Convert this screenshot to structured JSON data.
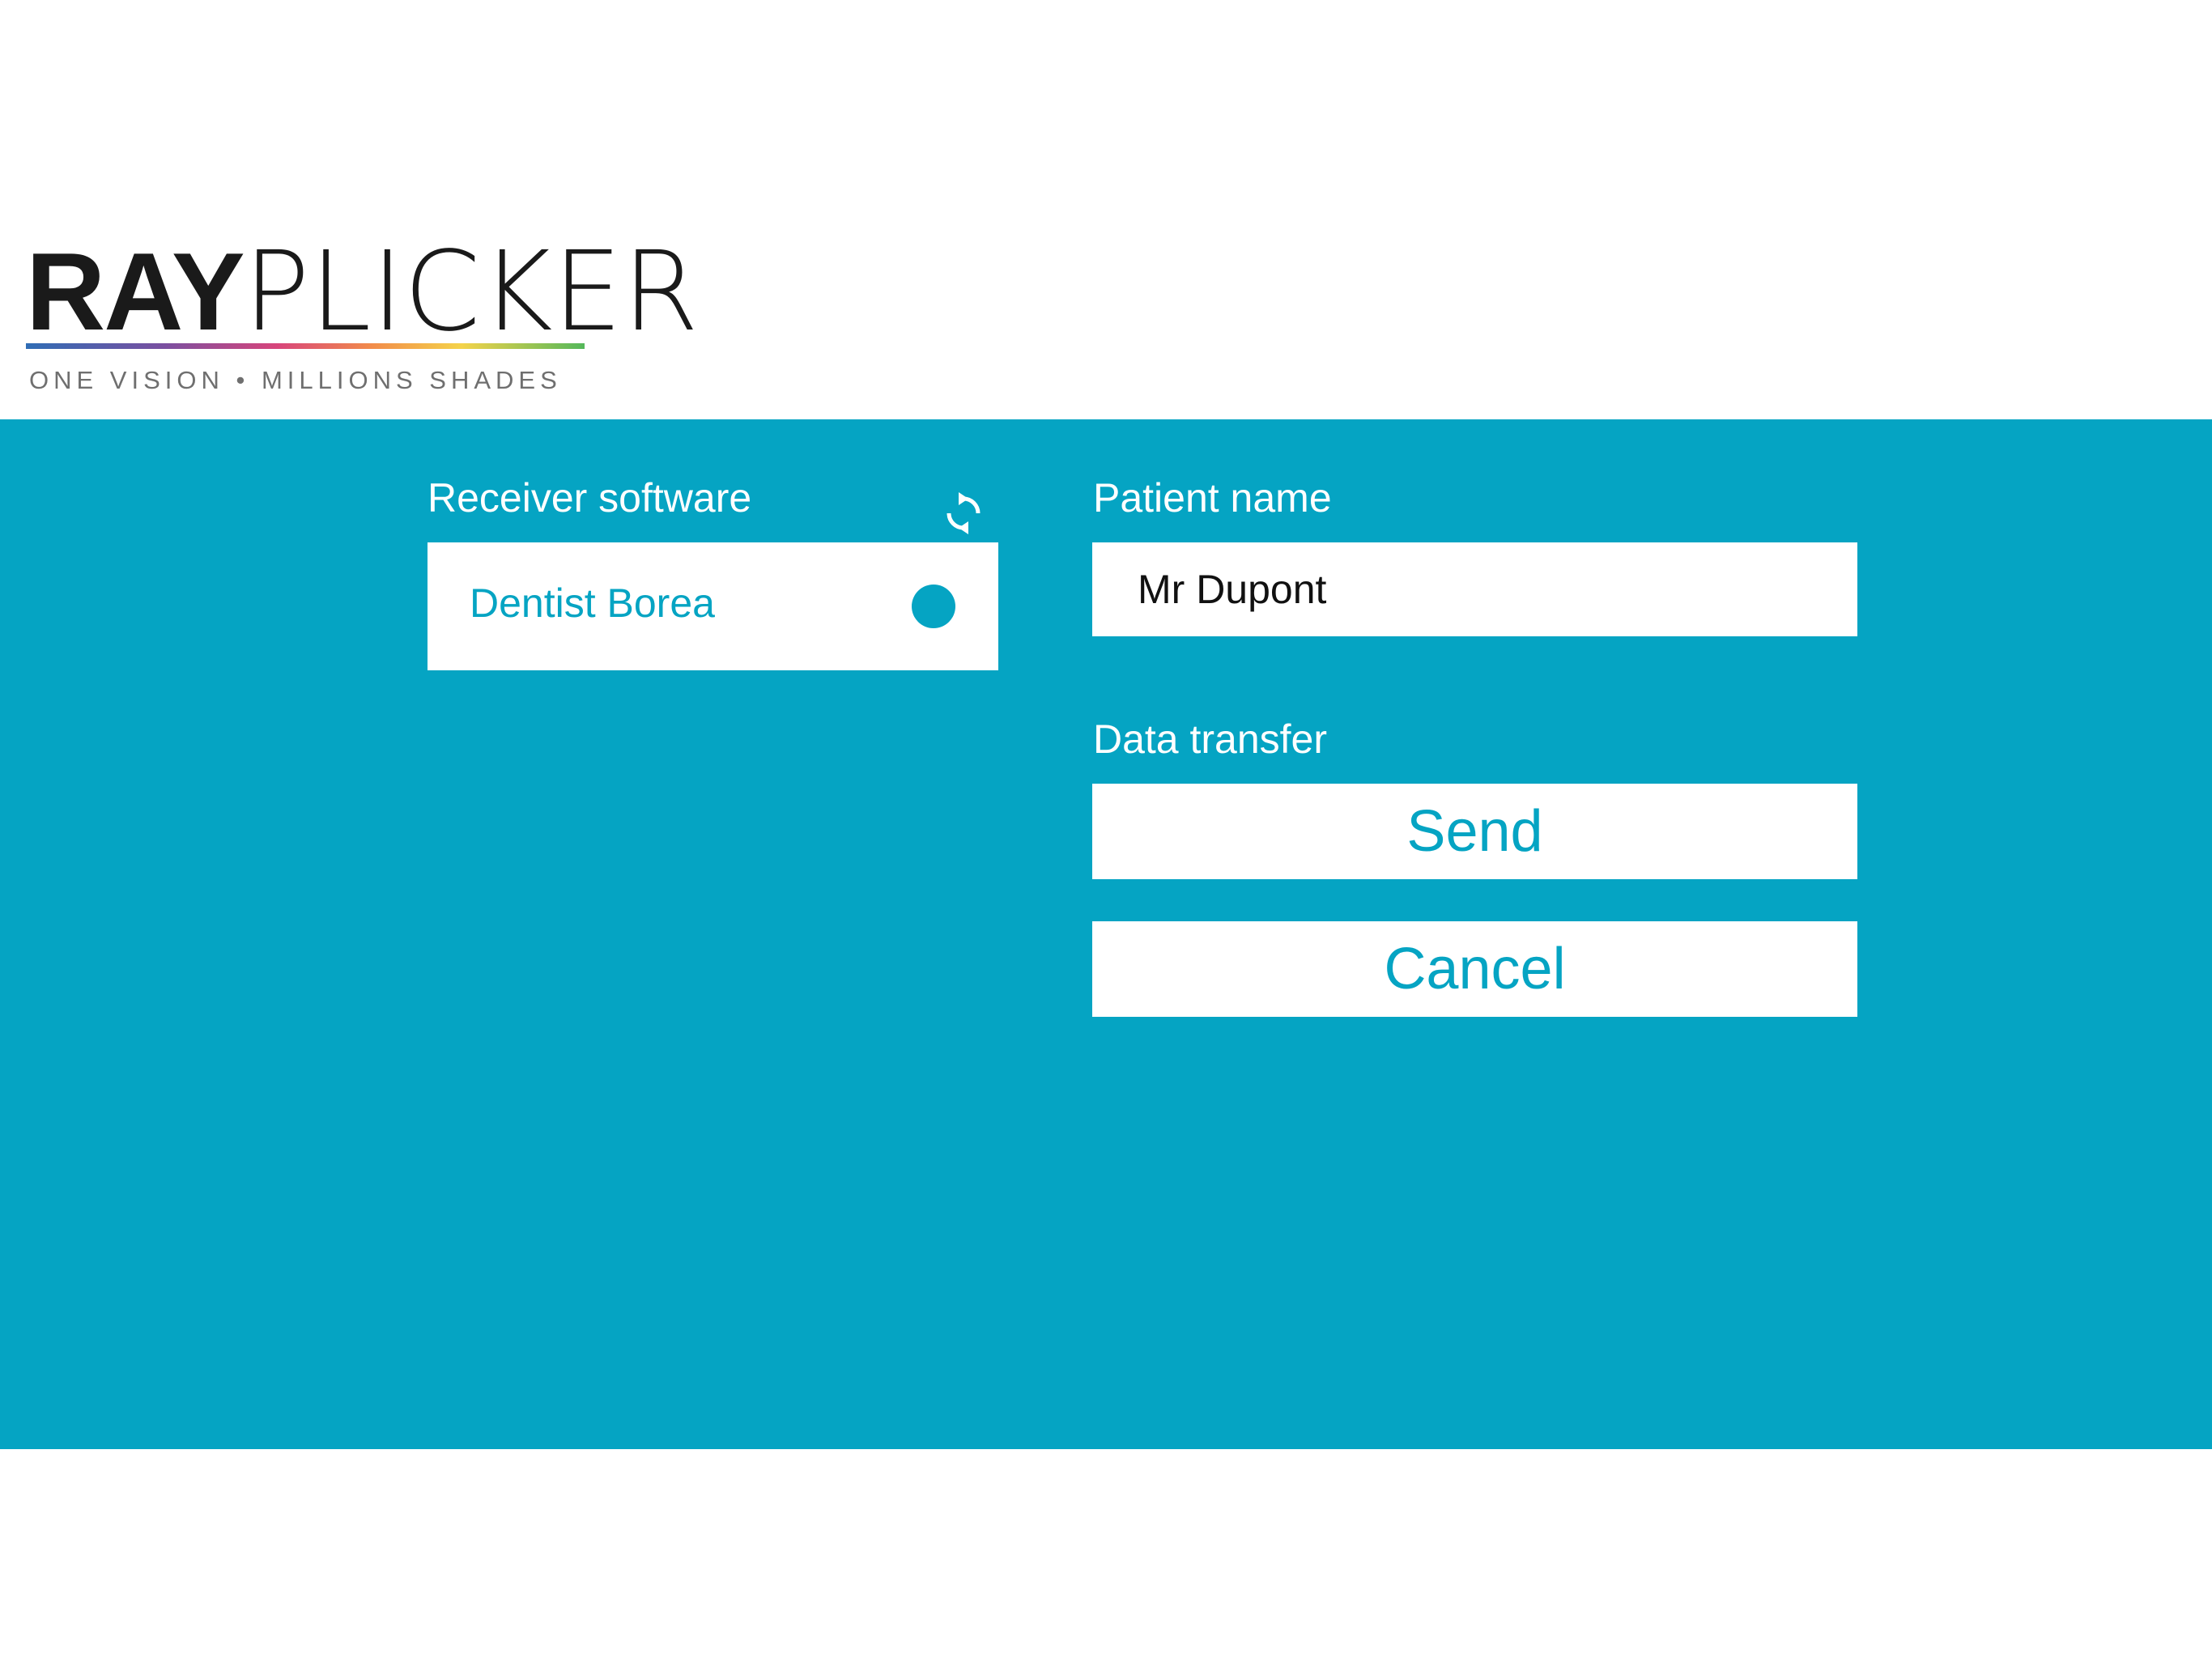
{
  "brand": {
    "name_bold": "RAY",
    "name_light": "PLICKER",
    "tagline": "ONE VISION • MILLIONS SHADES"
  },
  "receiver": {
    "label": "Receiver software",
    "refresh_icon": "refresh-icon",
    "items": [
      {
        "label": "Dentist Borea",
        "selected": true
      }
    ]
  },
  "patient": {
    "label": "Patient name",
    "value": "Mr Dupont"
  },
  "transfer": {
    "label": "Data transfer",
    "send_label": "Send",
    "cancel_label": "Cancel"
  },
  "colors": {
    "panel": "#05a4c3",
    "accent": "#05a4c3",
    "surface": "#ffffff"
  }
}
